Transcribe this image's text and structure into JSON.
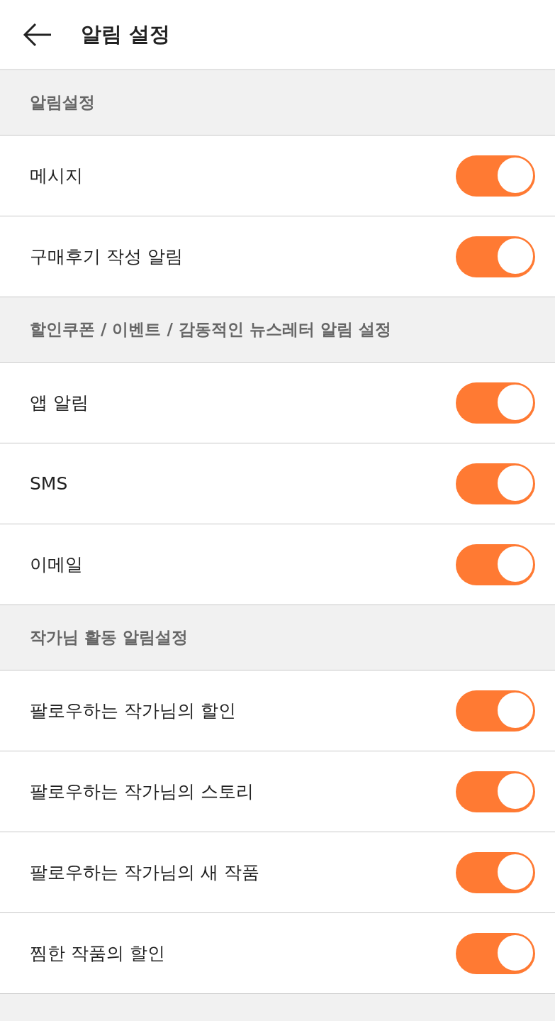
{
  "header": {
    "title": "알림 설정"
  },
  "sections": [
    {
      "title": "알림설정",
      "items": [
        {
          "label": "메시지",
          "on": true
        },
        {
          "label": "구매후기 작성 알림",
          "on": true
        }
      ]
    },
    {
      "title": "할인쿠폰 / 이벤트 / 감동적인 뉴스레터 알림 설정",
      "items": [
        {
          "label": "앱 알림",
          "on": true
        },
        {
          "label": "SMS",
          "on": true
        },
        {
          "label": "이메일",
          "on": true
        }
      ]
    },
    {
      "title": "작가님 활동 알림설정",
      "items": [
        {
          "label": "팔로우하는 작가님의 할인",
          "on": true
        },
        {
          "label": "팔로우하는 작가님의 스토리",
          "on": true
        },
        {
          "label": "팔로우하는 작가님의 새 작품",
          "on": true
        },
        {
          "label": "찜한 작품의 할인",
          "on": true
        }
      ]
    }
  ]
}
